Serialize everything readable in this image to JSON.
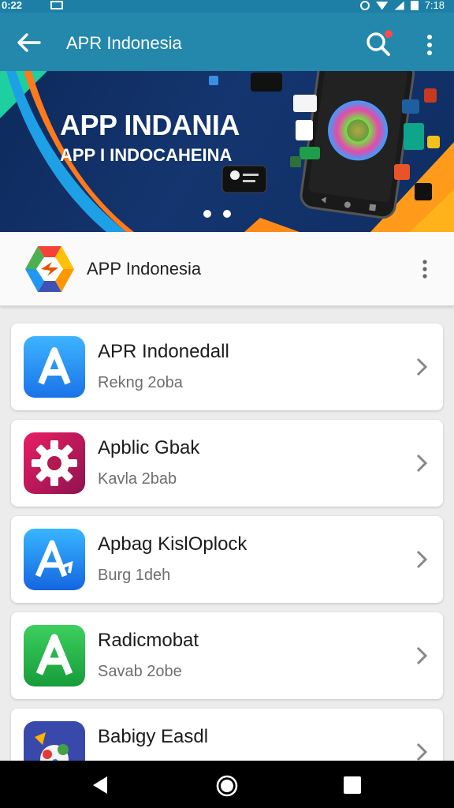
{
  "status_bar": {
    "time": "0:22",
    "right_text": "7:18"
  },
  "app_bar": {
    "title": "APR Indonesia",
    "icons": [
      "back-arrow-icon",
      "search-icon",
      "more-vert-icon"
    ]
  },
  "banner": {
    "title": "APP INDANIA",
    "subtitle": "APP I INDOCAHEINA",
    "pages": 2
  },
  "brand": {
    "name": "APP Indonesia"
  },
  "apps": [
    {
      "name": "APR Indonedall",
      "sub": "Rekng 2oba",
      "icon": "letter-a-icon",
      "color": "#2a8cf0"
    },
    {
      "name": "Apblic Gbak",
      "sub": "Kavla 2bab",
      "icon": "gear-icon",
      "color": "#c2185b"
    },
    {
      "name": "Apbag KislOplock",
      "sub": "Burg 1deh",
      "icon": "letter-a-icon",
      "color": "#1e90f2"
    },
    {
      "name": "Radicmobat",
      "sub": "Savab 2obe",
      "icon": "letter-a-icon",
      "color": "#25b34a"
    },
    {
      "name": "Babigy Easdl",
      "sub": "",
      "icon": "game-icon",
      "color": "#3949ab"
    }
  ],
  "nav": {
    "icons": [
      "nav-back-icon",
      "nav-home-icon",
      "nav-recent-icon"
    ]
  }
}
